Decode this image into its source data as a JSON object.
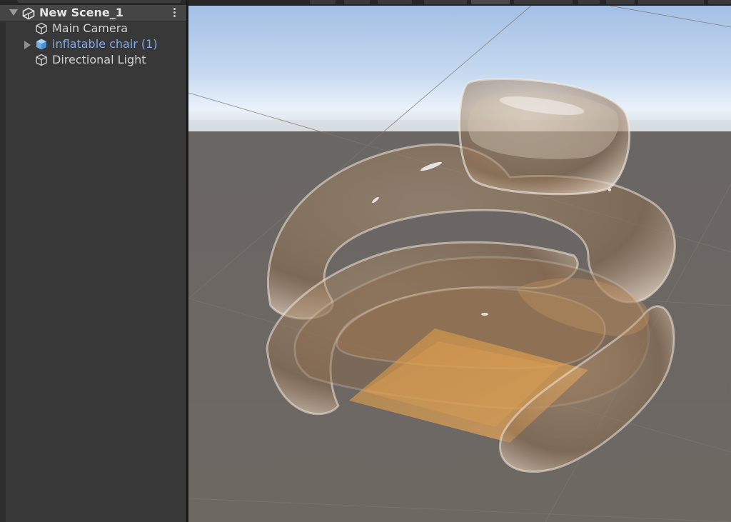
{
  "hierarchy": {
    "scene": {
      "name": "New Scene_1"
    },
    "items": [
      {
        "label": "Main Camera",
        "type": "camera"
      },
      {
        "label": "inflatable chair (1)",
        "type": "prefab",
        "expandable": true
      },
      {
        "label": "Directional Light",
        "type": "light"
      }
    ]
  },
  "colors": {
    "panel_bg": "#383838",
    "scene_header_bg": "#454545",
    "text": "#d2d2d2",
    "prefab_text": "#7ea9ea",
    "sky_top": "#a6c2e6",
    "horizon": "#eef4fa",
    "ground": "#6d6762",
    "chair_tint": "#c99a5e"
  }
}
